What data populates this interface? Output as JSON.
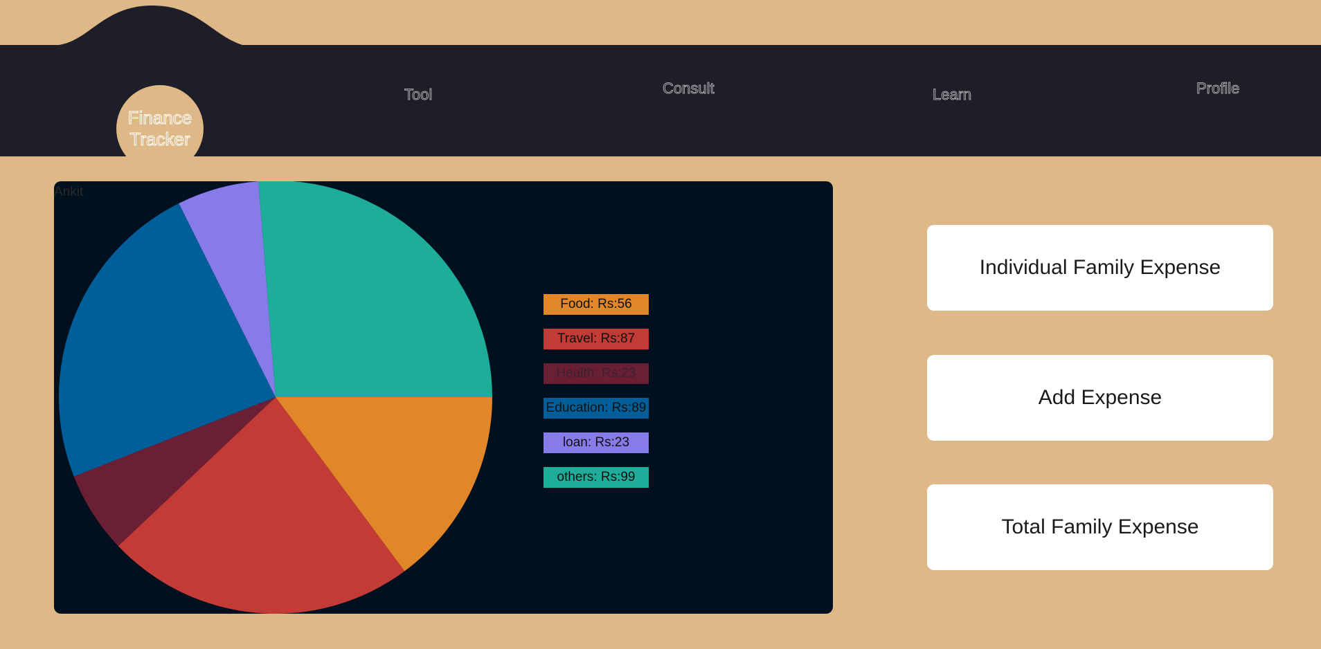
{
  "header": {
    "logo_line1": "Finance",
    "logo_line2": "Tracker",
    "nav": [
      "Tool",
      "Consult",
      "Learn",
      "Profile"
    ]
  },
  "chart_card": {
    "user_name": "Ankit"
  },
  "chart_data": {
    "type": "pie",
    "title": "",
    "categories": [
      "Food",
      "Travel",
      "Health",
      "Education",
      "loan",
      "others"
    ],
    "values": [
      56,
      87,
      23,
      89,
      23,
      99
    ],
    "labels": [
      "Food: Rs:56",
      "Travel: Rs:87",
      "Health: Rs:23",
      "Education: Rs:89",
      "loan: Rs:23",
      "others: Rs:99"
    ],
    "colors": [
      "#E2862A",
      "#C23B37",
      "#6A1F35",
      "#005F9A",
      "#877BE9",
      "#1EAD98"
    ],
    "start_angle_deg": 0,
    "direction": "clockwise",
    "legend_position": "right"
  },
  "actions": {
    "individual": "Individual Family Expense",
    "add": "Add Expense",
    "total": "Total Family Expense"
  },
  "colors": {
    "page_bg": "#DEB887",
    "header_bg": "#1E1E28",
    "card_bg": "#00101E",
    "button_bg": "#FFFFFF"
  }
}
